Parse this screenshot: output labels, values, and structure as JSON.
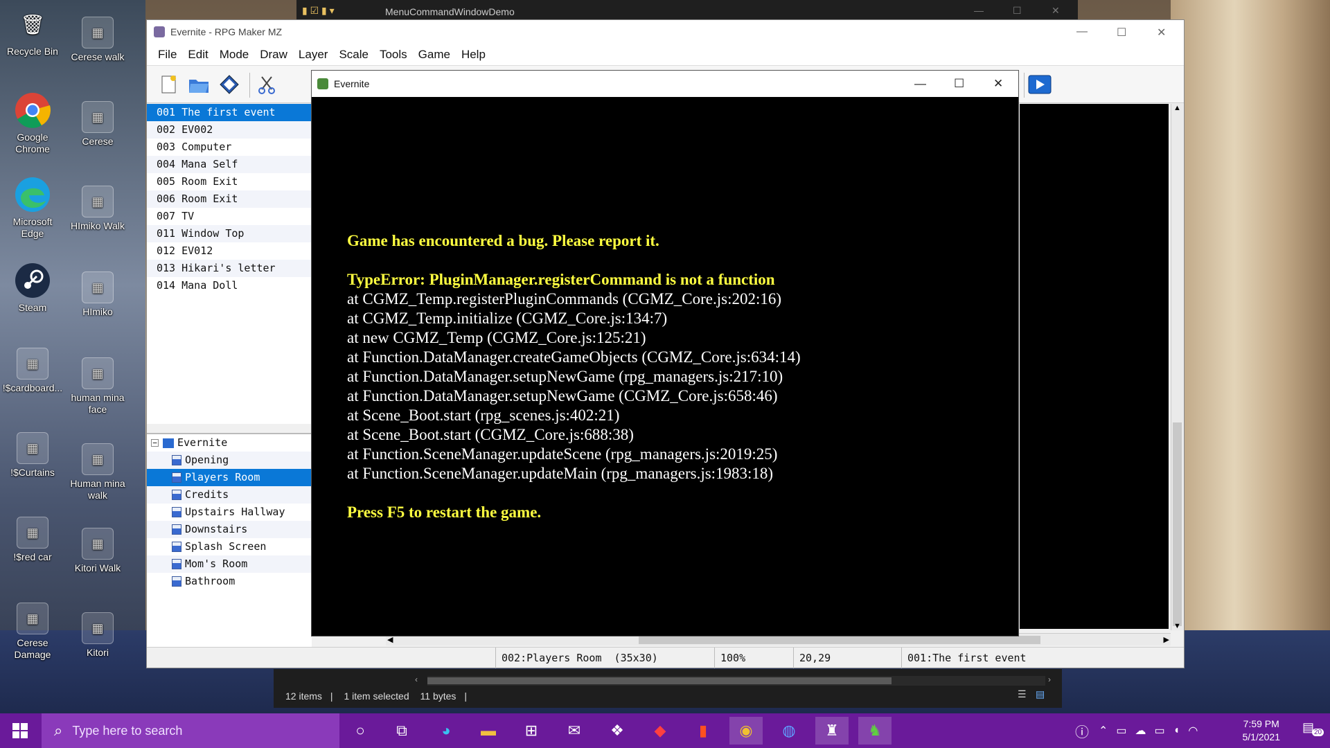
{
  "desktop": {
    "icons": [
      {
        "label": "Recycle Bin",
        "icon": "recycle-bin-icon"
      },
      {
        "label": "Cerese walk",
        "icon": "sprite-file-icon"
      },
      {
        "label": "Google Chrome",
        "icon": "chrome-icon"
      },
      {
        "label": "Cerese",
        "icon": "sprite-file-icon"
      },
      {
        "label": "Microsoft Edge",
        "icon": "edge-icon"
      },
      {
        "label": "HImiko Walk",
        "icon": "sprite-file-icon"
      },
      {
        "label": "Steam",
        "icon": "steam-icon"
      },
      {
        "label": "HImiko",
        "icon": "sprite-file-icon"
      },
      {
        "label": "!$cardboard...",
        "icon": "sprite-file-icon"
      },
      {
        "label": "human mina face",
        "icon": "sprite-file-icon"
      },
      {
        "label": "!$Curtains",
        "icon": "sprite-file-icon"
      },
      {
        "label": "Human mina walk",
        "icon": "sprite-file-icon"
      },
      {
        "label": "!$red car",
        "icon": "sprite-file-icon"
      },
      {
        "label": "Kitori Walk",
        "icon": "sprite-file-icon"
      },
      {
        "label": "Cerese Damage",
        "icon": "sprite-file-icon"
      },
      {
        "label": "Kitori",
        "icon": "sprite-file-icon"
      }
    ]
  },
  "explorer": {
    "title": "MenuCommandWindowDemo",
    "status_items": "12 items",
    "status_selected": "1 item selected",
    "status_size": "11 bytes"
  },
  "rpgmaker": {
    "title": "Evernite - RPG Maker MZ",
    "menu": [
      "File",
      "Edit",
      "Mode",
      "Draw",
      "Layer",
      "Scale",
      "Tools",
      "Game",
      "Help"
    ],
    "events": [
      "001 The first event",
      "002 EV002",
      "003 Computer",
      "004 Mana Self",
      "005 Room Exit",
      "006 Room Exit",
      "007 TV",
      "011 Window Top",
      "012 EV012",
      "013 Hikari's letter",
      "014 Mana Doll"
    ],
    "selected_event_index": 0,
    "project_name": "Evernite",
    "maps": [
      "Opening",
      "Players Room",
      "Credits",
      "Upstairs Hallway",
      "Downstairs",
      "Splash Screen",
      "Mom's Room",
      "Bathroom"
    ],
    "selected_map_index": 1,
    "status": {
      "map": "002:Players Room  (35x30)",
      "zoom": "100%",
      "coords": "20,29",
      "event": "001:The first event"
    }
  },
  "game_window": {
    "title": "Evernite",
    "error_heading": "Game has encountered a bug. Please report it.",
    "error_type": "TypeError: PluginManager.registerCommand is not a function",
    "stack": [
      "at CGMZ_Temp.registerPluginCommands (CGMZ_Core.js:202:16)",
      "at CGMZ_Temp.initialize (CGMZ_Core.js:134:7)",
      "at new CGMZ_Temp (CGMZ_Core.js:125:21)",
      "at Function.DataManager.createGameObjects (CGMZ_Core.js:634:14)",
      "at Function.DataManager.setupNewGame (rpg_managers.js:217:10)",
      "at Function.DataManager.setupNewGame (CGMZ_Core.js:658:46)",
      "at Scene_Boot.start (rpg_scenes.js:402:21)",
      "at Scene_Boot.start (CGMZ_Core.js:688:38)",
      "at Function.SceneManager.updateScene (rpg_managers.js:2019:25)",
      "at Function.SceneManager.updateMain (rpg_managers.js:1983:18)"
    ],
    "footer": "Press F5 to restart the game."
  },
  "taskbar": {
    "search_placeholder": "Type here to search",
    "time": "7:59 PM",
    "date": "5/1/2021",
    "notification_count": "20"
  },
  "colors": {
    "taskbar": "#6a1a9a",
    "selection": "#0a78d7",
    "error_yellow": "#ffff40"
  }
}
